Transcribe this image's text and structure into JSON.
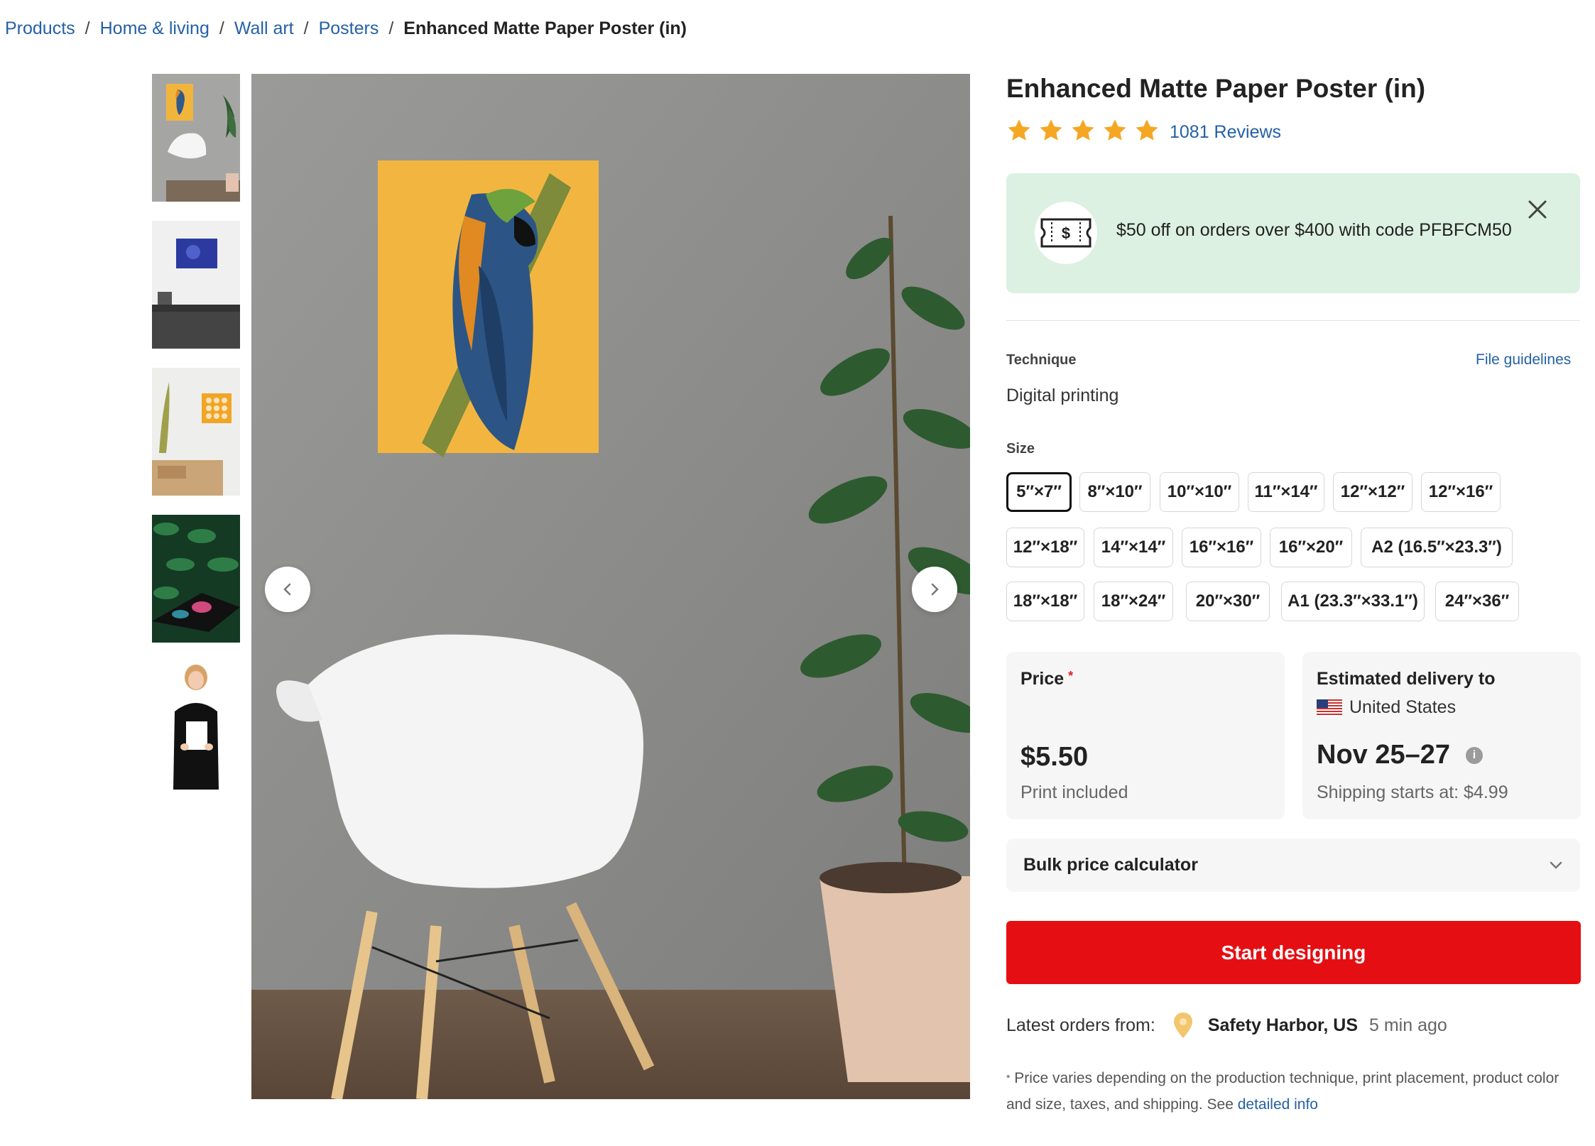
{
  "breadcrumb": {
    "items": [
      "Products",
      "Home & living",
      "Wall art",
      "Posters"
    ],
    "current": "Enhanced Matte Paper Poster (in)",
    "separator": "/"
  },
  "thumbnails": [
    {
      "name": "thumb-parrot-room",
      "active": true
    },
    {
      "name": "thumb-office-desk",
      "active": false
    },
    {
      "name": "thumb-shelf-room",
      "active": false
    },
    {
      "name": "thumb-leaf-pattern",
      "active": false
    },
    {
      "name": "thumb-woman-holding-poster",
      "active": false
    }
  ],
  "product": {
    "title": "Enhanced Matte Paper Poster (in)",
    "rating": 5,
    "reviews": "1081 Reviews"
  },
  "promo": {
    "text": "$50 off on orders over $400 with code PFBFCM50",
    "icon": "coupon-icon",
    "icon_text": "$",
    "bg_color": "#dcf1e1"
  },
  "technique": {
    "label": "Technique",
    "value": "Digital printing",
    "guidelines_link": "File guidelines"
  },
  "size": {
    "label": "Size",
    "selected": "5″×7″",
    "rows": [
      [
        "5″×7″",
        "8″×10″",
        "10″×10″",
        "11″×14″",
        "12″×12″",
        "12″×16″"
      ],
      [
        "12″×18″",
        "14″×14″",
        "16″×16″",
        "16″×20″",
        "A2 (16.5″×23.3″)"
      ],
      [
        "18″×18″",
        "18″×24″",
        "20″×30″",
        "A1 (23.3″×33.1″)",
        "24″×36″"
      ]
    ]
  },
  "price": {
    "label": "Price",
    "required_mark": "*",
    "value": "$5.50",
    "note": "Print included"
  },
  "delivery": {
    "label": "Estimated delivery to",
    "country": "United States",
    "dates": "Nov 25–27",
    "shipping": "Shipping starts at: $4.99",
    "info_icon": "i"
  },
  "bulk": {
    "label": "Bulk price calculator"
  },
  "cta": {
    "label": "Start designing",
    "color": "#e50f13"
  },
  "orders": {
    "label": "Latest orders from:",
    "location": "Safety Harbor, US",
    "time": "5 min ago"
  },
  "disclaimer": {
    "mark": "*",
    "text": "Price varies depending on the production technique, print placement, product color and size, taxes, and shipping. See",
    "link": "detailed info"
  },
  "colors": {
    "link": "#2461a6",
    "accent_red": "#e50f13",
    "star": "#f5a623"
  }
}
